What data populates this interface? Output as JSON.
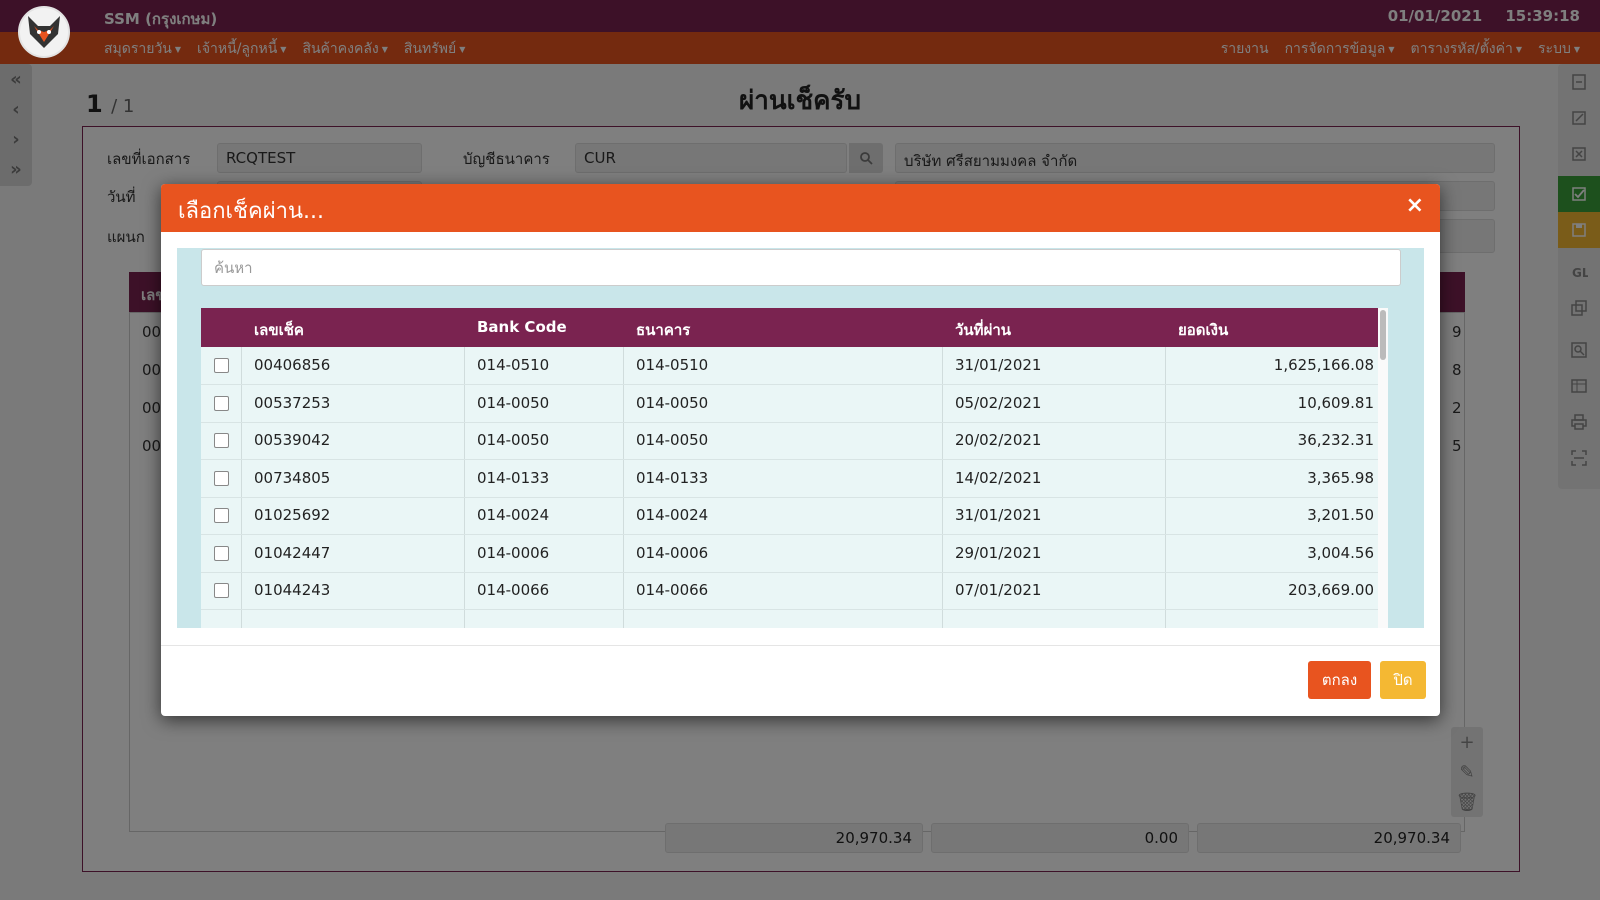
{
  "app": {
    "title": "SSM (กรุงเกษม)",
    "date": "01/01/2021",
    "time": "15:39:18"
  },
  "nav": {
    "left": [
      "สมุดรายวัน",
      "เจ้าหนี้/ลูกหนี้",
      "สินค้าคงคลัง",
      "สินทรัพย์"
    ],
    "right": [
      "รายงาน",
      "การจัดการข้อมูล",
      "ตารางรหัส/ตั้งค่า",
      "ระบบ"
    ]
  },
  "page": {
    "current": "1",
    "total": "/ 1",
    "title": "ผ่านเช็ครับ"
  },
  "form": {
    "doc_no_label": "เลขที่เอกสาร",
    "doc_no": "RCQTEST",
    "bank_account_label": "บัญชีธนาคาร",
    "bank_account": "CUR",
    "company": "บริษัท ศรีสยามมงคล จำกัด",
    "date_label": "วันที่",
    "dept_label": "แผนก",
    "grid_header_partial": "เลข",
    "grid_rows_partial": [
      "00",
      "00",
      "00",
      "00"
    ],
    "grid_rows_right_partial": [
      "9",
      "8",
      "2",
      "5"
    ],
    "totals": [
      "20,970.34",
      "0.00",
      "20,970.34"
    ]
  },
  "modal": {
    "title": "เลือกเช็คผ่าน...",
    "close_glyph": "×",
    "search_placeholder": "ค้นหา",
    "columns": [
      "เลขเช็ค",
      "Bank Code",
      "ธนาคาร",
      "วันที่ผ่าน",
      "ยอดเงิน"
    ],
    "rows": [
      {
        "cheque": "00406856",
        "bank_code": "014-0510",
        "bank": "014-0510",
        "date": "31/01/2021",
        "amount": "1,625,166.08"
      },
      {
        "cheque": "00537253",
        "bank_code": "014-0050",
        "bank": "014-0050",
        "date": "05/02/2021",
        "amount": "10,609.81"
      },
      {
        "cheque": "00539042",
        "bank_code": "014-0050",
        "bank": "014-0050",
        "date": "20/02/2021",
        "amount": "36,232.31"
      },
      {
        "cheque": "00734805",
        "bank_code": "014-0133",
        "bank": "014-0133",
        "date": "14/02/2021",
        "amount": "3,365.98"
      },
      {
        "cheque": "01025692",
        "bank_code": "014-0024",
        "bank": "014-0024",
        "date": "31/01/2021",
        "amount": "3,201.50"
      },
      {
        "cheque": "01042447",
        "bank_code": "014-0006",
        "bank": "014-0006",
        "date": "29/01/2021",
        "amount": "3,004.56"
      },
      {
        "cheque": "01044243",
        "bank_code": "014-0066",
        "bank": "014-0066",
        "date": "07/01/2021",
        "amount": "203,669.00"
      }
    ],
    "ok_label": "ตกลง",
    "close_label": "ปิด"
  },
  "colors": {
    "primary": "#7a2350",
    "accent": "#e8541f",
    "warning": "#f4b833",
    "success": "#3aa13a"
  },
  "icons": {
    "left_pager": [
      "first-page-icon",
      "prev-page-icon",
      "next-page-icon",
      "last-page-icon"
    ],
    "toolbar": [
      "new-doc-icon",
      "edit-doc-icon",
      "cancel-doc-icon",
      "approve-icon",
      "save-icon",
      "gl-icon",
      "copy-icon",
      "preview-icon",
      "table-icon",
      "print-icon",
      "scan-icon"
    ]
  }
}
